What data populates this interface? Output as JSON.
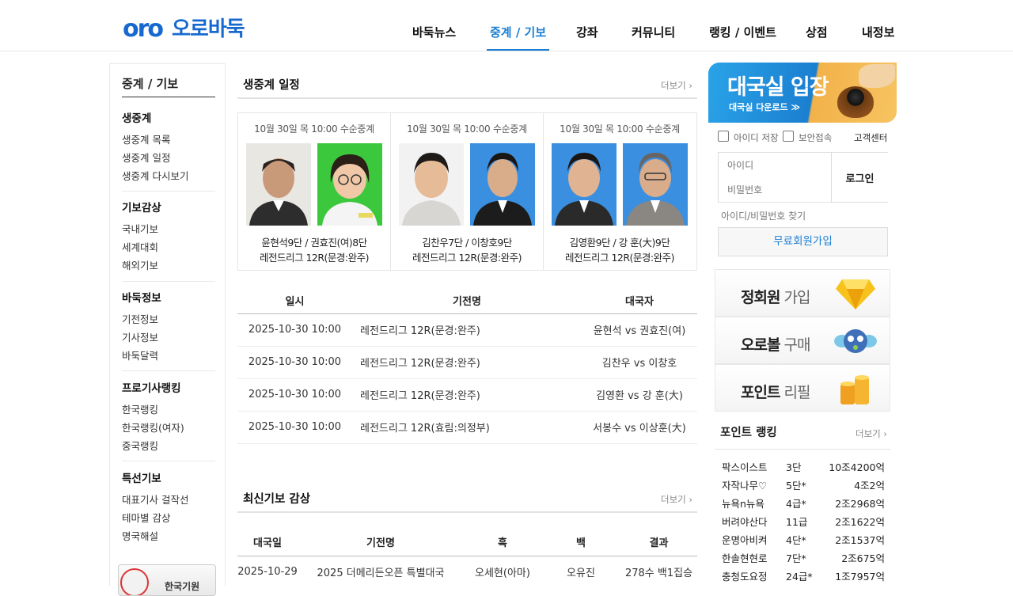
{
  "header": {
    "logo_mark": "oro",
    "logo_text": "오로바둑",
    "nav": [
      "바둑뉴스",
      "중계 / 기보",
      "강좌",
      "커뮤니티",
      "랭킹 / 이벤트",
      "상점",
      "내정보"
    ]
  },
  "sidebar": {
    "title": "중계 / 기보",
    "groups": [
      {
        "title": "생중계",
        "items": [
          "생중계 목록",
          "생중계 일정",
          "생중계 다시보기"
        ]
      },
      {
        "title": "기보감상",
        "items": [
          "국내기보",
          "세계대회",
          "해외기보"
        ]
      },
      {
        "title": "바둑정보",
        "items": [
          "기전정보",
          "기사정보",
          "바둑달력"
        ]
      },
      {
        "title": "프로기사랭킹",
        "items": [
          "한국랭킹",
          "한국랭킹(여자)",
          "중국랭킹"
        ]
      },
      {
        "title": "특선기보",
        "items": [
          "대표기사 걸작선",
          "테마별 감상",
          "명국해설"
        ]
      }
    ],
    "banner_text": "한국기원"
  },
  "live_schedule": {
    "title": "생중계 일정",
    "more": "더보기 ›",
    "cards": [
      {
        "date": "10월 30일 목 10:00  수순중계",
        "players": "윤현석9단 / 권효진(여)8단",
        "league": "레전드리그 12R(문경:완주)"
      },
      {
        "date": "10월 30일 목 10:00  수순중계",
        "players": "김찬우7단 / 이창호9단",
        "league": "레전드리그 12R(문경:완주)"
      },
      {
        "date": "10월 30일 목 10:00  수순중계",
        "players": "김영환9단 / 강 훈(大)9단",
        "league": "레전드리그 12R(문경:완주)"
      }
    ],
    "headers": [
      "일시",
      "기전명",
      "대국자"
    ],
    "rows": [
      [
        "2025-10-30  10:00",
        "레전드리그 12R(문경:완주)",
        "윤현석 vs 권효진(여)"
      ],
      [
        "2025-10-30  10:00",
        "레전드리그 12R(문경:완주)",
        "김찬우 vs 이창호"
      ],
      [
        "2025-10-30  10:00",
        "레전드리그 12R(문경:완주)",
        "김영환 vs 강 훈(大)"
      ],
      [
        "2025-10-30  10:00",
        "레전드리그 12R(효림:의정부)",
        "서봉수 vs 이상훈(大)"
      ]
    ]
  },
  "recent_games": {
    "title": "최신기보 감상",
    "more": "더보기 ›",
    "headers": [
      "대국일",
      "기전명",
      "흑",
      "백",
      "결과"
    ],
    "rows": [
      [
        "2025-10-29",
        "2025 더메리든오픈 특별대국",
        "오세현(아마)",
        "오유진",
        "278수 백1집승"
      ]
    ]
  },
  "right": {
    "banner_title": "대국실 입장",
    "banner_sub": "대국실 다운로드 ≫",
    "save_id": "아이디 저장",
    "secure": "보안접속",
    "support": "고객센터",
    "id_placeholder": "아이디",
    "pw_placeholder": "비밀번호",
    "login": "로그인",
    "find": "아이디/비밀번호 찾기",
    "join": "무료회원가입",
    "promos": [
      {
        "bold": "정회원",
        "rest": " 가입"
      },
      {
        "bold": "오로볼",
        "rest": " 구매"
      },
      {
        "bold": "포인트",
        "rest": " 리필"
      }
    ],
    "ranking_title": "포인트 랭킹",
    "ranking_more": "더보기 ›",
    "ranking": [
      {
        "name": "팍스이스트",
        "level": "3단",
        "points": "10조4200억"
      },
      {
        "name": "자작나무♡",
        "level": "5단*",
        "points": "4조2억"
      },
      {
        "name": "뉴욕n뉴욕",
        "level": "4급*",
        "points": "2조2968억"
      },
      {
        "name": "버려야산다",
        "level": "11급",
        "points": "2조1622억"
      },
      {
        "name": "운명아비켜",
        "level": "4단*",
        "points": "2조1537억"
      },
      {
        "name": "한솔현현로",
        "level": "7단*",
        "points": "2조675억"
      },
      {
        "name": "충청도요정",
        "level": "24급*",
        "points": "1조7957억"
      }
    ]
  }
}
